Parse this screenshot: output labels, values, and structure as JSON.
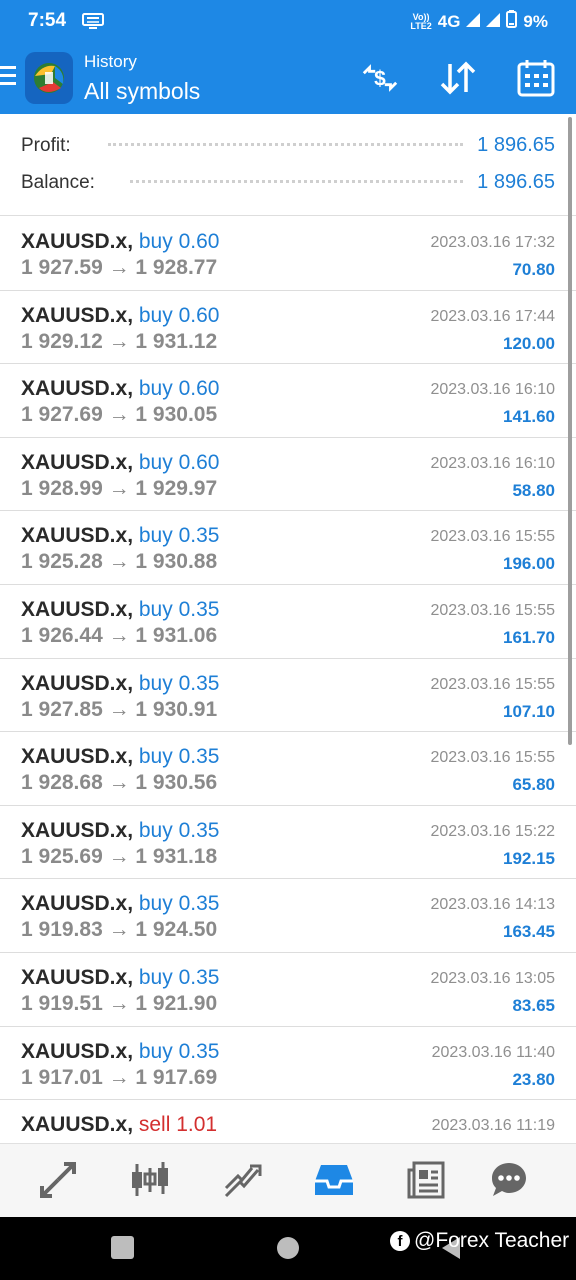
{
  "status_bar": {
    "time": "7:54",
    "network": "4G",
    "volte_top": "Vo))",
    "volte_bottom": "LTE2",
    "battery": "9%"
  },
  "app_bar": {
    "subtitle": "History",
    "title": "All symbols",
    "icons": [
      "menu-icon",
      "metatrader-logo",
      "currency-filter-icon",
      "sort-icon",
      "calendar-icon"
    ]
  },
  "summary": {
    "profit_label": "Profit:",
    "profit_value": "1 896.65",
    "balance_label": "Balance:",
    "balance_value": "1 896.65"
  },
  "deals": [
    {
      "symbol": "XAUUSD.x,",
      "action": "buy 0.60",
      "type": "buy",
      "prices": "1 927.59 → 1 928.77",
      "time": "2023.03.16 17:32",
      "profit": "70.80"
    },
    {
      "symbol": "XAUUSD.x,",
      "action": "buy 0.60",
      "type": "buy",
      "prices": "1 929.12 → 1 931.12",
      "time": "2023.03.16 17:44",
      "profit": "120.00"
    },
    {
      "symbol": "XAUUSD.x,",
      "action": "buy 0.60",
      "type": "buy",
      "prices": "1 927.69 → 1 930.05",
      "time": "2023.03.16 16:10",
      "profit": "141.60"
    },
    {
      "symbol": "XAUUSD.x,",
      "action": "buy 0.60",
      "type": "buy",
      "prices": "1 928.99 → 1 929.97",
      "time": "2023.03.16 16:10",
      "profit": "58.80"
    },
    {
      "symbol": "XAUUSD.x,",
      "action": "buy 0.35",
      "type": "buy",
      "prices": "1 925.28 → 1 930.88",
      "time": "2023.03.16 15:55",
      "profit": "196.00"
    },
    {
      "symbol": "XAUUSD.x,",
      "action": "buy 0.35",
      "type": "buy",
      "prices": "1 926.44 → 1 931.06",
      "time": "2023.03.16 15:55",
      "profit": "161.70"
    },
    {
      "symbol": "XAUUSD.x,",
      "action": "buy 0.35",
      "type": "buy",
      "prices": "1 927.85 → 1 930.91",
      "time": "2023.03.16 15:55",
      "profit": "107.10"
    },
    {
      "symbol": "XAUUSD.x,",
      "action": "buy 0.35",
      "type": "buy",
      "prices": "1 928.68 → 1 930.56",
      "time": "2023.03.16 15:55",
      "profit": "65.80"
    },
    {
      "symbol": "XAUUSD.x,",
      "action": "buy 0.35",
      "type": "buy",
      "prices": "1 925.69 → 1 931.18",
      "time": "2023.03.16 15:22",
      "profit": "192.15"
    },
    {
      "symbol": "XAUUSD.x,",
      "action": "buy 0.35",
      "type": "buy",
      "prices": "1 919.83 → 1 924.50",
      "time": "2023.03.16 14:13",
      "profit": "163.45"
    },
    {
      "symbol": "XAUUSD.x,",
      "action": "buy 0.35",
      "type": "buy",
      "prices": "1 919.51 → 1 921.90",
      "time": "2023.03.16 13:05",
      "profit": "83.65"
    },
    {
      "symbol": "XAUUSD.x,",
      "action": "buy 0.35",
      "type": "buy",
      "prices": "1 917.01 → 1 917.69",
      "time": "2023.03.16 11:40",
      "profit": "23.80"
    },
    {
      "symbol": "XAUUSD.x,",
      "action": "sell 1.01",
      "type": "sell",
      "prices": "",
      "time": "2023.03.16 11:19",
      "profit": ""
    }
  ],
  "bottom_nav": {
    "items": [
      "quotes-icon",
      "chart-icon",
      "trade-icon",
      "history-icon",
      "news-icon",
      "chat-icon"
    ],
    "active": "history-icon"
  },
  "watermark": "@Forex Teacher",
  "colors": {
    "accent": "#1e88e5",
    "value_blue": "#1e7fd6",
    "sell_red": "#d32f2f",
    "muted": "#8a8a8a"
  }
}
